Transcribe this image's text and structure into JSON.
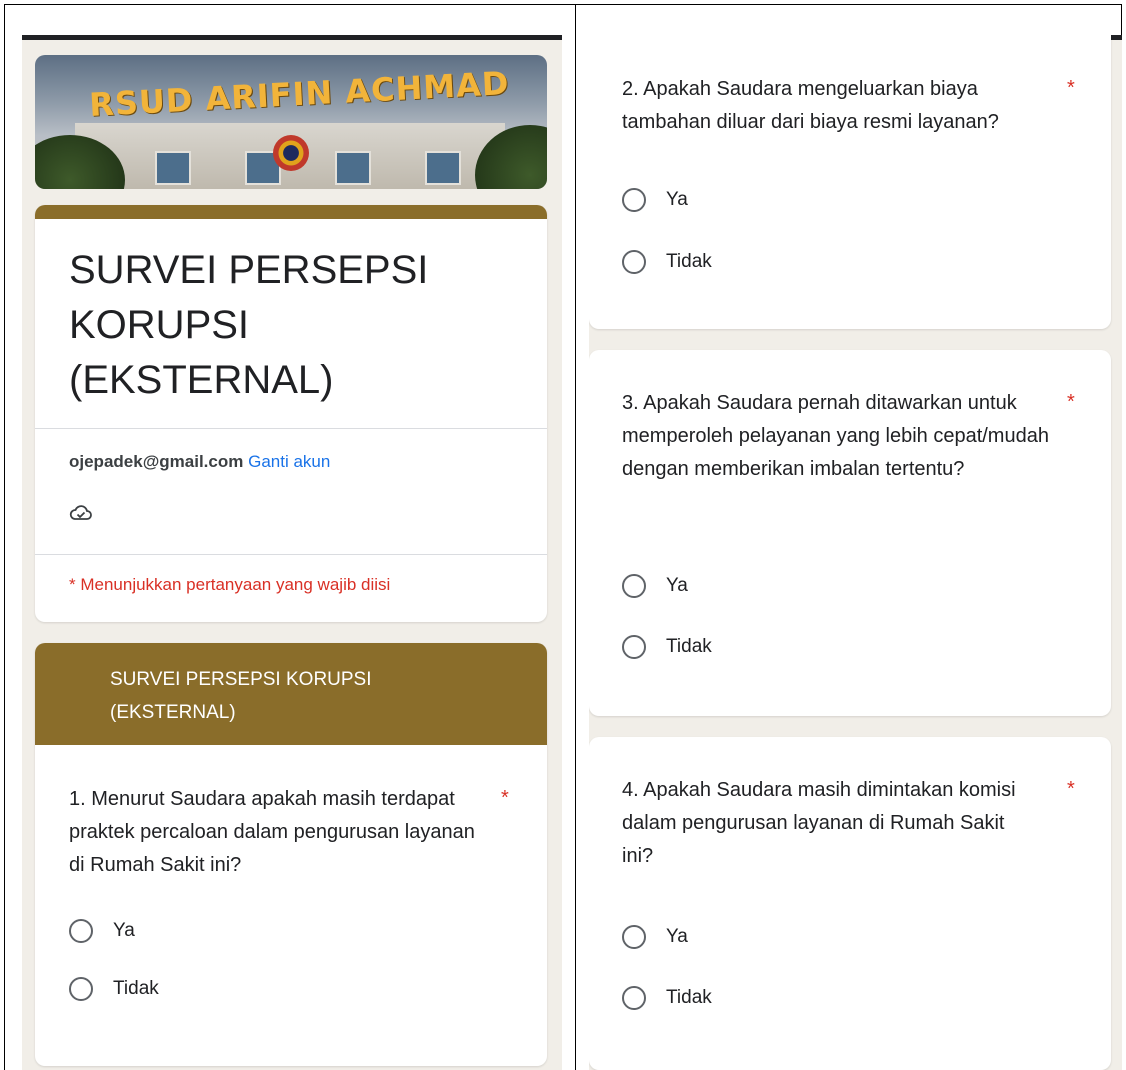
{
  "banner": {
    "sign_text": "RSUD ARIFIN ACHMAD"
  },
  "form": {
    "title": "SURVEI PERSEPSI KORUPSI (EKSTERNAL)",
    "account_email": "ojepadek@gmail.com",
    "switch_account_label": "Ganti akun",
    "required_note": "* Menunjukkan pertanyaan yang wajib diisi"
  },
  "section": {
    "title": "SURVEI PERSEPSI KORUPSI (EKSTERNAL)"
  },
  "questions": [
    {
      "text": "1. Menurut Saudara apakah masih terdapat praktek percaloan dalam pengurusan layanan di Rumah Sakit ini?",
      "required_mark": "*",
      "options": [
        "Ya",
        "Tidak"
      ]
    },
    {
      "text": "2. Apakah Saudara mengeluarkan biaya tambahan diluar dari biaya resmi layanan?",
      "required_mark": "*",
      "options": [
        "Ya",
        "Tidak"
      ]
    },
    {
      "text": "3. Apakah Saudara pernah ditawarkan untuk memperoleh pelayanan yang lebih cepat/mudah dengan memberikan imbalan tertentu?",
      "required_mark": "*",
      "options": [
        "Ya",
        "Tidak"
      ]
    },
    {
      "text": "4. Apakah Saudara masih dimintakan komisi dalam pengurusan layanan di Rumah Sakit ini?",
      "required_mark": "*",
      "options": [
        "Ya",
        "Tidak"
      ]
    }
  ],
  "colors": {
    "accent": "#8a6d2a",
    "required": "#d93025",
    "link": "#1a73e8",
    "background": "#f1eee8"
  },
  "icons": {
    "cloud_saved": "cloud-check-icon"
  }
}
